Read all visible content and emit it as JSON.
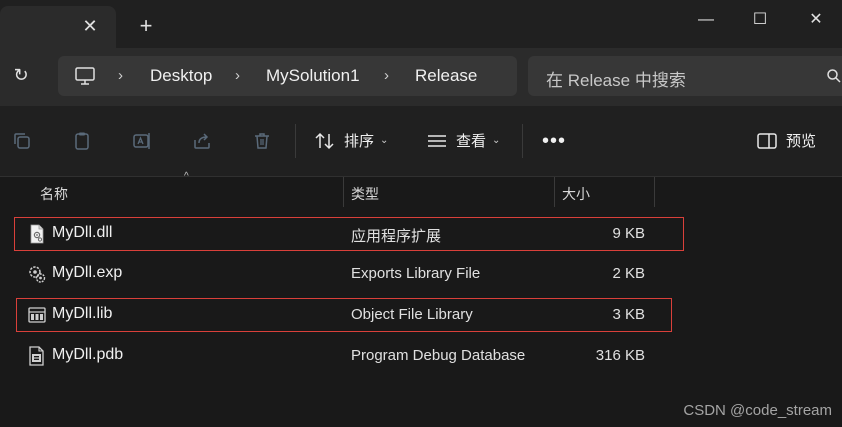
{
  "titlebar": {
    "close_tab_glyph": "✕",
    "new_tab_glyph": "+",
    "minimize_glyph": "—",
    "maximize_glyph": "☐",
    "close_window_glyph": "✕"
  },
  "address": {
    "refresh_glyph": "↻",
    "separator_glyph": "›",
    "crumbs": [
      "Desktop",
      "MySolution1",
      "Release"
    ],
    "search_placeholder": "在 Release 中搜索"
  },
  "toolbar": {
    "sort_label": "排序",
    "view_label": "查看",
    "more_glyph": "•••",
    "preview_label": "预览",
    "dropdown_glyph": "⌄"
  },
  "columns": {
    "name": "名称",
    "type": "类型",
    "size": "大小",
    "sort_glyph": "^"
  },
  "files": [
    {
      "name": "MyDll.dll",
      "type": "应用程序扩展",
      "size": "9 KB",
      "icon": "dll-file-icon",
      "highlighted": true
    },
    {
      "name": "MyDll.exp",
      "type": "Exports Library File",
      "size": "2 KB",
      "icon": "exp-file-icon",
      "highlighted": false
    },
    {
      "name": "MyDll.lib",
      "type": "Object File Library",
      "size": "3 KB",
      "icon": "lib-file-icon",
      "highlighted": true
    },
    {
      "name": "MyDll.pdb",
      "type": "Program Debug Database",
      "size": "316 KB",
      "icon": "pdb-file-icon",
      "highlighted": false
    }
  ],
  "colors": {
    "highlight_border": "#d9403a",
    "background": "#191919"
  },
  "watermark": "CSDN @code_stream"
}
